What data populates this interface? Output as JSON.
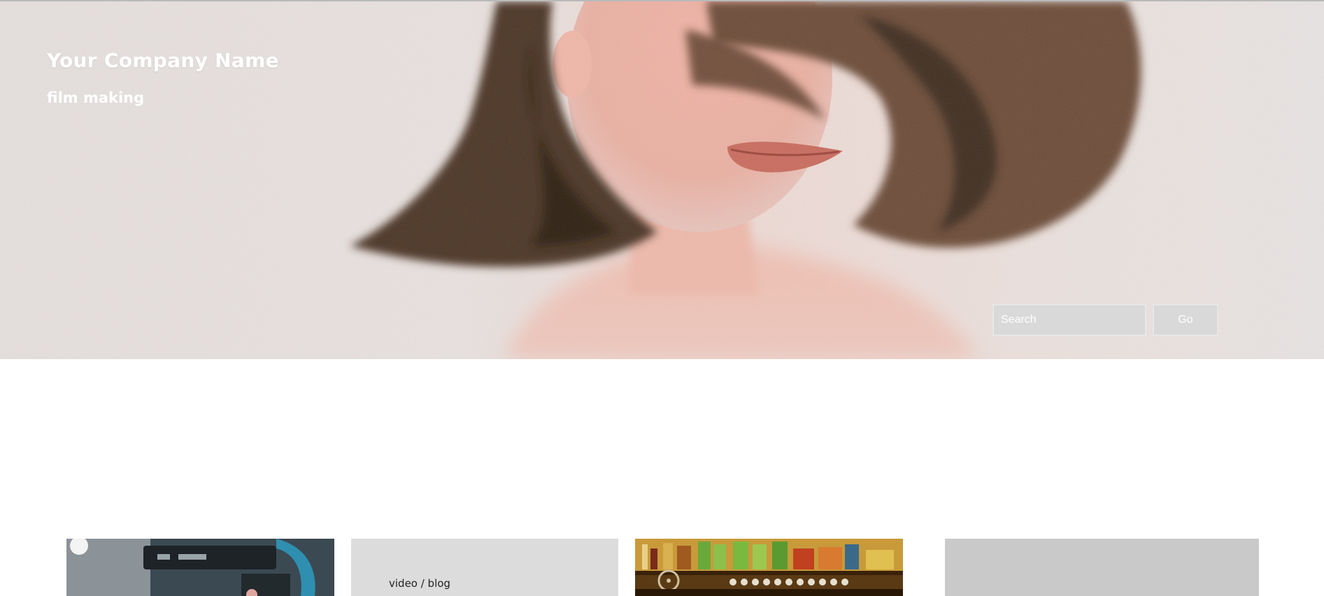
{
  "header": {
    "company_name": "Your Company Name",
    "tagline": "film making"
  },
  "search": {
    "placeholder": "Search",
    "go_label": "Go"
  },
  "cards": [
    {
      "kind": "image",
      "image": "film-camera-photo"
    },
    {
      "kind": "text",
      "label": "video / blog"
    },
    {
      "kind": "image",
      "image": "film-equipment-shelf-photo"
    },
    {
      "kind": "placeholder"
    }
  ],
  "colors": {
    "input_background": "#d9d9d9",
    "input_border": "#e7e7e7",
    "text_card_background": "#dcdcdc",
    "placeholder_card_background": "#c9c9c9"
  }
}
